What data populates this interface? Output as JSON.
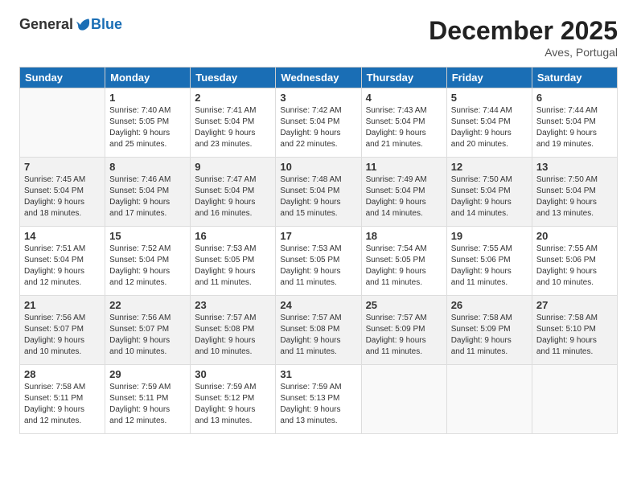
{
  "logo": {
    "general": "General",
    "blue": "Blue"
  },
  "header": {
    "month": "December 2025",
    "location": "Aves, Portugal"
  },
  "weekdays": [
    "Sunday",
    "Monday",
    "Tuesday",
    "Wednesday",
    "Thursday",
    "Friday",
    "Saturday"
  ],
  "weeks": [
    [
      {
        "day": "",
        "info": ""
      },
      {
        "day": "1",
        "info": "Sunrise: 7:40 AM\nSunset: 5:05 PM\nDaylight: 9 hours\nand 25 minutes."
      },
      {
        "day": "2",
        "info": "Sunrise: 7:41 AM\nSunset: 5:04 PM\nDaylight: 9 hours\nand 23 minutes."
      },
      {
        "day": "3",
        "info": "Sunrise: 7:42 AM\nSunset: 5:04 PM\nDaylight: 9 hours\nand 22 minutes."
      },
      {
        "day": "4",
        "info": "Sunrise: 7:43 AM\nSunset: 5:04 PM\nDaylight: 9 hours\nand 21 minutes."
      },
      {
        "day": "5",
        "info": "Sunrise: 7:44 AM\nSunset: 5:04 PM\nDaylight: 9 hours\nand 20 minutes."
      },
      {
        "day": "6",
        "info": "Sunrise: 7:44 AM\nSunset: 5:04 PM\nDaylight: 9 hours\nand 19 minutes."
      }
    ],
    [
      {
        "day": "7",
        "info": "Sunrise: 7:45 AM\nSunset: 5:04 PM\nDaylight: 9 hours\nand 18 minutes."
      },
      {
        "day": "8",
        "info": "Sunrise: 7:46 AM\nSunset: 5:04 PM\nDaylight: 9 hours\nand 17 minutes."
      },
      {
        "day": "9",
        "info": "Sunrise: 7:47 AM\nSunset: 5:04 PM\nDaylight: 9 hours\nand 16 minutes."
      },
      {
        "day": "10",
        "info": "Sunrise: 7:48 AM\nSunset: 5:04 PM\nDaylight: 9 hours\nand 15 minutes."
      },
      {
        "day": "11",
        "info": "Sunrise: 7:49 AM\nSunset: 5:04 PM\nDaylight: 9 hours\nand 14 minutes."
      },
      {
        "day": "12",
        "info": "Sunrise: 7:50 AM\nSunset: 5:04 PM\nDaylight: 9 hours\nand 14 minutes."
      },
      {
        "day": "13",
        "info": "Sunrise: 7:50 AM\nSunset: 5:04 PM\nDaylight: 9 hours\nand 13 minutes."
      }
    ],
    [
      {
        "day": "14",
        "info": "Sunrise: 7:51 AM\nSunset: 5:04 PM\nDaylight: 9 hours\nand 12 minutes."
      },
      {
        "day": "15",
        "info": "Sunrise: 7:52 AM\nSunset: 5:04 PM\nDaylight: 9 hours\nand 12 minutes."
      },
      {
        "day": "16",
        "info": "Sunrise: 7:53 AM\nSunset: 5:05 PM\nDaylight: 9 hours\nand 11 minutes."
      },
      {
        "day": "17",
        "info": "Sunrise: 7:53 AM\nSunset: 5:05 PM\nDaylight: 9 hours\nand 11 minutes."
      },
      {
        "day": "18",
        "info": "Sunrise: 7:54 AM\nSunset: 5:05 PM\nDaylight: 9 hours\nand 11 minutes."
      },
      {
        "day": "19",
        "info": "Sunrise: 7:55 AM\nSunset: 5:06 PM\nDaylight: 9 hours\nand 11 minutes."
      },
      {
        "day": "20",
        "info": "Sunrise: 7:55 AM\nSunset: 5:06 PM\nDaylight: 9 hours\nand 10 minutes."
      }
    ],
    [
      {
        "day": "21",
        "info": "Sunrise: 7:56 AM\nSunset: 5:07 PM\nDaylight: 9 hours\nand 10 minutes."
      },
      {
        "day": "22",
        "info": "Sunrise: 7:56 AM\nSunset: 5:07 PM\nDaylight: 9 hours\nand 10 minutes."
      },
      {
        "day": "23",
        "info": "Sunrise: 7:57 AM\nSunset: 5:08 PM\nDaylight: 9 hours\nand 10 minutes."
      },
      {
        "day": "24",
        "info": "Sunrise: 7:57 AM\nSunset: 5:08 PM\nDaylight: 9 hours\nand 11 minutes."
      },
      {
        "day": "25",
        "info": "Sunrise: 7:57 AM\nSunset: 5:09 PM\nDaylight: 9 hours\nand 11 minutes."
      },
      {
        "day": "26",
        "info": "Sunrise: 7:58 AM\nSunset: 5:09 PM\nDaylight: 9 hours\nand 11 minutes."
      },
      {
        "day": "27",
        "info": "Sunrise: 7:58 AM\nSunset: 5:10 PM\nDaylight: 9 hours\nand 11 minutes."
      }
    ],
    [
      {
        "day": "28",
        "info": "Sunrise: 7:58 AM\nSunset: 5:11 PM\nDaylight: 9 hours\nand 12 minutes."
      },
      {
        "day": "29",
        "info": "Sunrise: 7:59 AM\nSunset: 5:11 PM\nDaylight: 9 hours\nand 12 minutes."
      },
      {
        "day": "30",
        "info": "Sunrise: 7:59 AM\nSunset: 5:12 PM\nDaylight: 9 hours\nand 13 minutes."
      },
      {
        "day": "31",
        "info": "Sunrise: 7:59 AM\nSunset: 5:13 PM\nDaylight: 9 hours\nand 13 minutes."
      },
      {
        "day": "",
        "info": ""
      },
      {
        "day": "",
        "info": ""
      },
      {
        "day": "",
        "info": ""
      }
    ]
  ]
}
